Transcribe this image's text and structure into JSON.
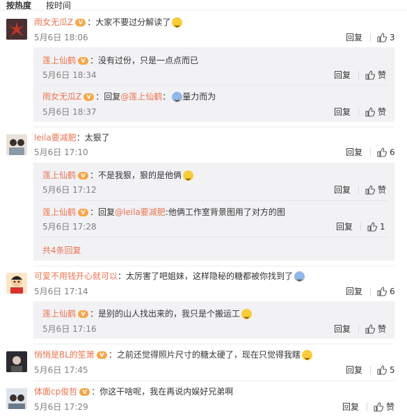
{
  "sort": {
    "hot": "按热度",
    "time": "按时间"
  },
  "reply_label": "回复",
  "like_label": "赞",
  "comments": [
    {
      "user": "雨女无瓜Z",
      "text": "：大家不要过分解读了",
      "date": "5月6日 18:06",
      "likes": "3",
      "replies": [
        {
          "user": "莲上仙鹤",
          "text": "：没有过份，只是一点点而已",
          "date": "5月6日 18:34",
          "likes": "赞"
        },
        {
          "user": "雨女无瓜Z",
          "prefix": "：回复",
          "mention": "@莲上仙鹤",
          "text": "：",
          "text2": "量力而为",
          "date": "5月6日 18:37",
          "likes": "赞"
        }
      ]
    },
    {
      "user": "leila要减肥",
      "text": "：太狠了",
      "date": "5月6日 17:10",
      "likes": "6",
      "replies": [
        {
          "user": "莲上仙鹤",
          "text": "：不是我狠，狠的是他俩",
          "date": "5月6日 17:12",
          "likes": "赞"
        },
        {
          "user": "莲上仙鹤",
          "prefix": "：回复",
          "mention": "@leila要减肥",
          "text": ":他俩工作室背景图用了对方的图",
          "date": "5月6日 17:28",
          "likes": "1"
        }
      ],
      "more": "共4条回复"
    },
    {
      "user": "可爱不用钱开心就可以",
      "text": "：太厉害了吧姐妹，这样隐秘的糖都被你找到了",
      "date": "5月6日 17:14",
      "likes": "6",
      "replies": [
        {
          "user": "莲上仙鹤",
          "text": "：是别的山人找出来的，我只是个搬运工",
          "date": "5月6日 17:16",
          "likes": "赞"
        }
      ]
    },
    {
      "user": "悄悄是BL的笙箫",
      "text": "：之前还觉得照片尺寸的糖太硬了，现在只觉得我瞎",
      "date": "5月6日 17:45",
      "likes": "5"
    },
    {
      "user": "体面cp俊哲",
      "text": "：你这干啥呢，我在再说内娱好兄弟啊",
      "date": "5月6日 17:29",
      "likes": "赞"
    }
  ]
}
